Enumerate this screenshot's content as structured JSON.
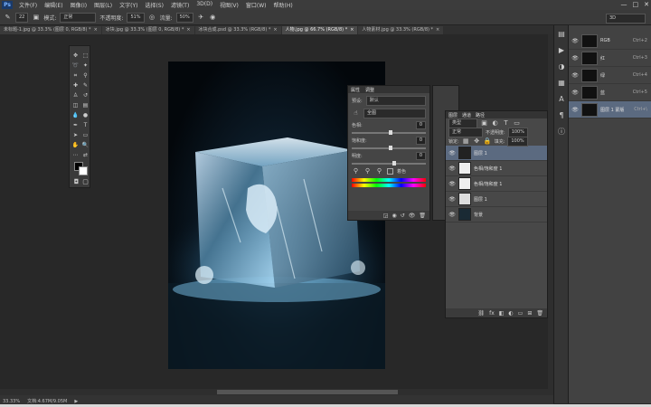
{
  "app": {
    "logo": "Ps"
  },
  "menu": [
    "文件(F)",
    "编辑(E)",
    "图像(I)",
    "图层(L)",
    "文字(Y)",
    "选择(S)",
    "滤镜(T)",
    "3D(D)",
    "视图(V)",
    "窗口(W)",
    "帮助(H)"
  ],
  "window_controls": [
    "—",
    "□",
    "✕"
  ],
  "options": {
    "size": "22",
    "mode_label": "模式:",
    "mode_value": "正常",
    "opacity_label": "不透明度:",
    "opacity_value": "51%",
    "flow_label": "流量:",
    "flow_value": "50%",
    "right_value": "3D"
  },
  "tabs": [
    {
      "label": "未标题-1.jpg @ 33.3% (图层 0, RGB/8) *",
      "active": false
    },
    {
      "label": "冰块.jpg @ 33.3% (图层 0, RGB/8) *",
      "active": false
    },
    {
      "label": "冰块合成.psd @ 33.3% (RGB/8) *",
      "active": false
    },
    {
      "label": "人物.jpg @ 66.7% (RGB/8) *",
      "active": true
    },
    {
      "label": "人物素材.jpg @ 33.3% (RGB/8) *",
      "active": false
    }
  ],
  "levels": {
    "title": "属性",
    "header_tab": "调整",
    "preset_label": "预设:",
    "preset_value": "默认",
    "channel_value": "全图",
    "hue_label": "色相:",
    "hue_value": "0",
    "sat_label": "饱和度:",
    "sat_value": "0",
    "light_label": "明度:",
    "light_value": "0",
    "colorize_label": "着色",
    "hue_pct": 0.5,
    "sat_pct": 0.5,
    "light_pct": 0.55
  },
  "layers_panel": {
    "tabs": [
      "图层",
      "通道",
      "路径"
    ],
    "filter_label": "类型",
    "blend_mode": "正常",
    "opacity_label": "不透明度:",
    "opacity_value": "100%",
    "fill_label": "填充:",
    "fill_value": "100%",
    "lock_label": "锁定:",
    "layers": [
      {
        "name": "图层 1",
        "selected": true
      },
      {
        "name": "色相/饱和度 1",
        "selected": false
      },
      {
        "name": "色相/饱和度 1",
        "selected": false
      },
      {
        "name": "图层 1",
        "selected": false
      },
      {
        "name": "背景",
        "selected": false
      }
    ],
    "footer_icons": [
      "⛓",
      "fx",
      "◧",
      "◐",
      "▭",
      "⊞",
      "🗑"
    ]
  },
  "channels_panel": {
    "channels": [
      {
        "name": "RGB",
        "key": "Ctrl+2",
        "selected": false
      },
      {
        "name": "红",
        "key": "Ctrl+3",
        "selected": false
      },
      {
        "name": "绿",
        "key": "Ctrl+4",
        "selected": false
      },
      {
        "name": "蓝",
        "key": "Ctrl+5",
        "selected": false
      },
      {
        "name": "图层 1 蒙版",
        "key": "Ctrl+\\",
        "selected": true
      }
    ]
  },
  "status": {
    "zoom": "33.33%",
    "doc": "文档:4.67M/9.05M"
  }
}
